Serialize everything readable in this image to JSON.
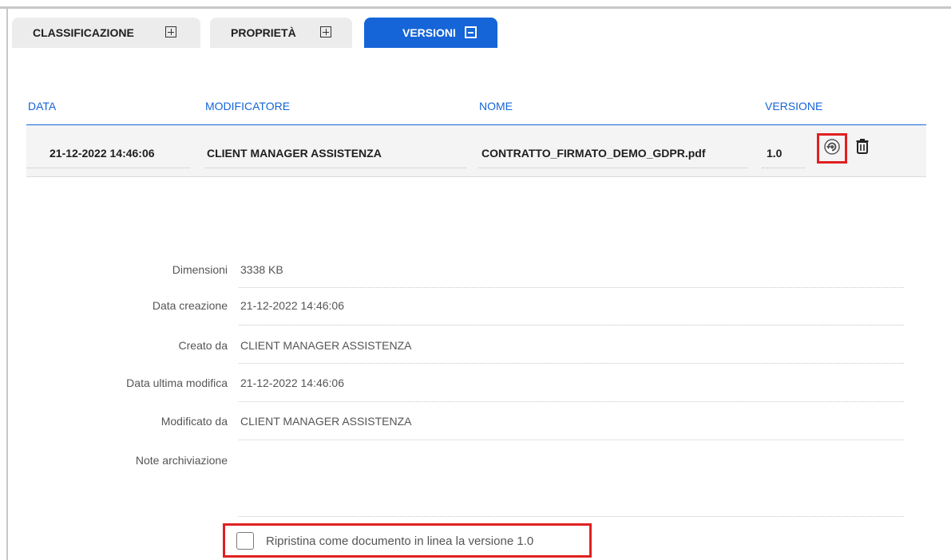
{
  "tabs": [
    {
      "label": "CLASSIFICAZIONE",
      "state": "collapsed"
    },
    {
      "label": "PROPRIETÀ",
      "state": "collapsed"
    },
    {
      "label": "VERSIONI",
      "state": "expanded"
    }
  ],
  "table": {
    "columns": [
      "DATA",
      "MODIFICATORE",
      "NOME",
      "VERSIONE"
    ],
    "rows": [
      {
        "data": "21-12-2022 14:46:06",
        "modificatore": "CLIENT MANAGER ASSISTENZA",
        "nome": "CONTRATTO_FIRMATO_DEMO_GDPR.pdf",
        "versione": "1.0",
        "actions": [
          "restore-icon",
          "trash-icon"
        ]
      }
    ]
  },
  "details": [
    {
      "label": "Dimensioni",
      "value": "3338 KB"
    },
    {
      "label": "Data creazione",
      "value": "21-12-2022 14:46:06"
    },
    {
      "label": "Creato da",
      "value": "CLIENT MANAGER ASSISTENZA"
    },
    {
      "label": "Data ultima modifica",
      "value": "21-12-2022 14:46:06"
    },
    {
      "label": "Modificato da",
      "value": "CLIENT MANAGER ASSISTENZA"
    },
    {
      "label": "Note archiviazione",
      "value": ""
    }
  ],
  "restore": {
    "label": "Ripristina come documento in linea la versione 1.0",
    "checked": false
  },
  "colors": {
    "accent": "#1565d8",
    "highlight": "#e02020",
    "tab_inactive": "#ececec"
  }
}
